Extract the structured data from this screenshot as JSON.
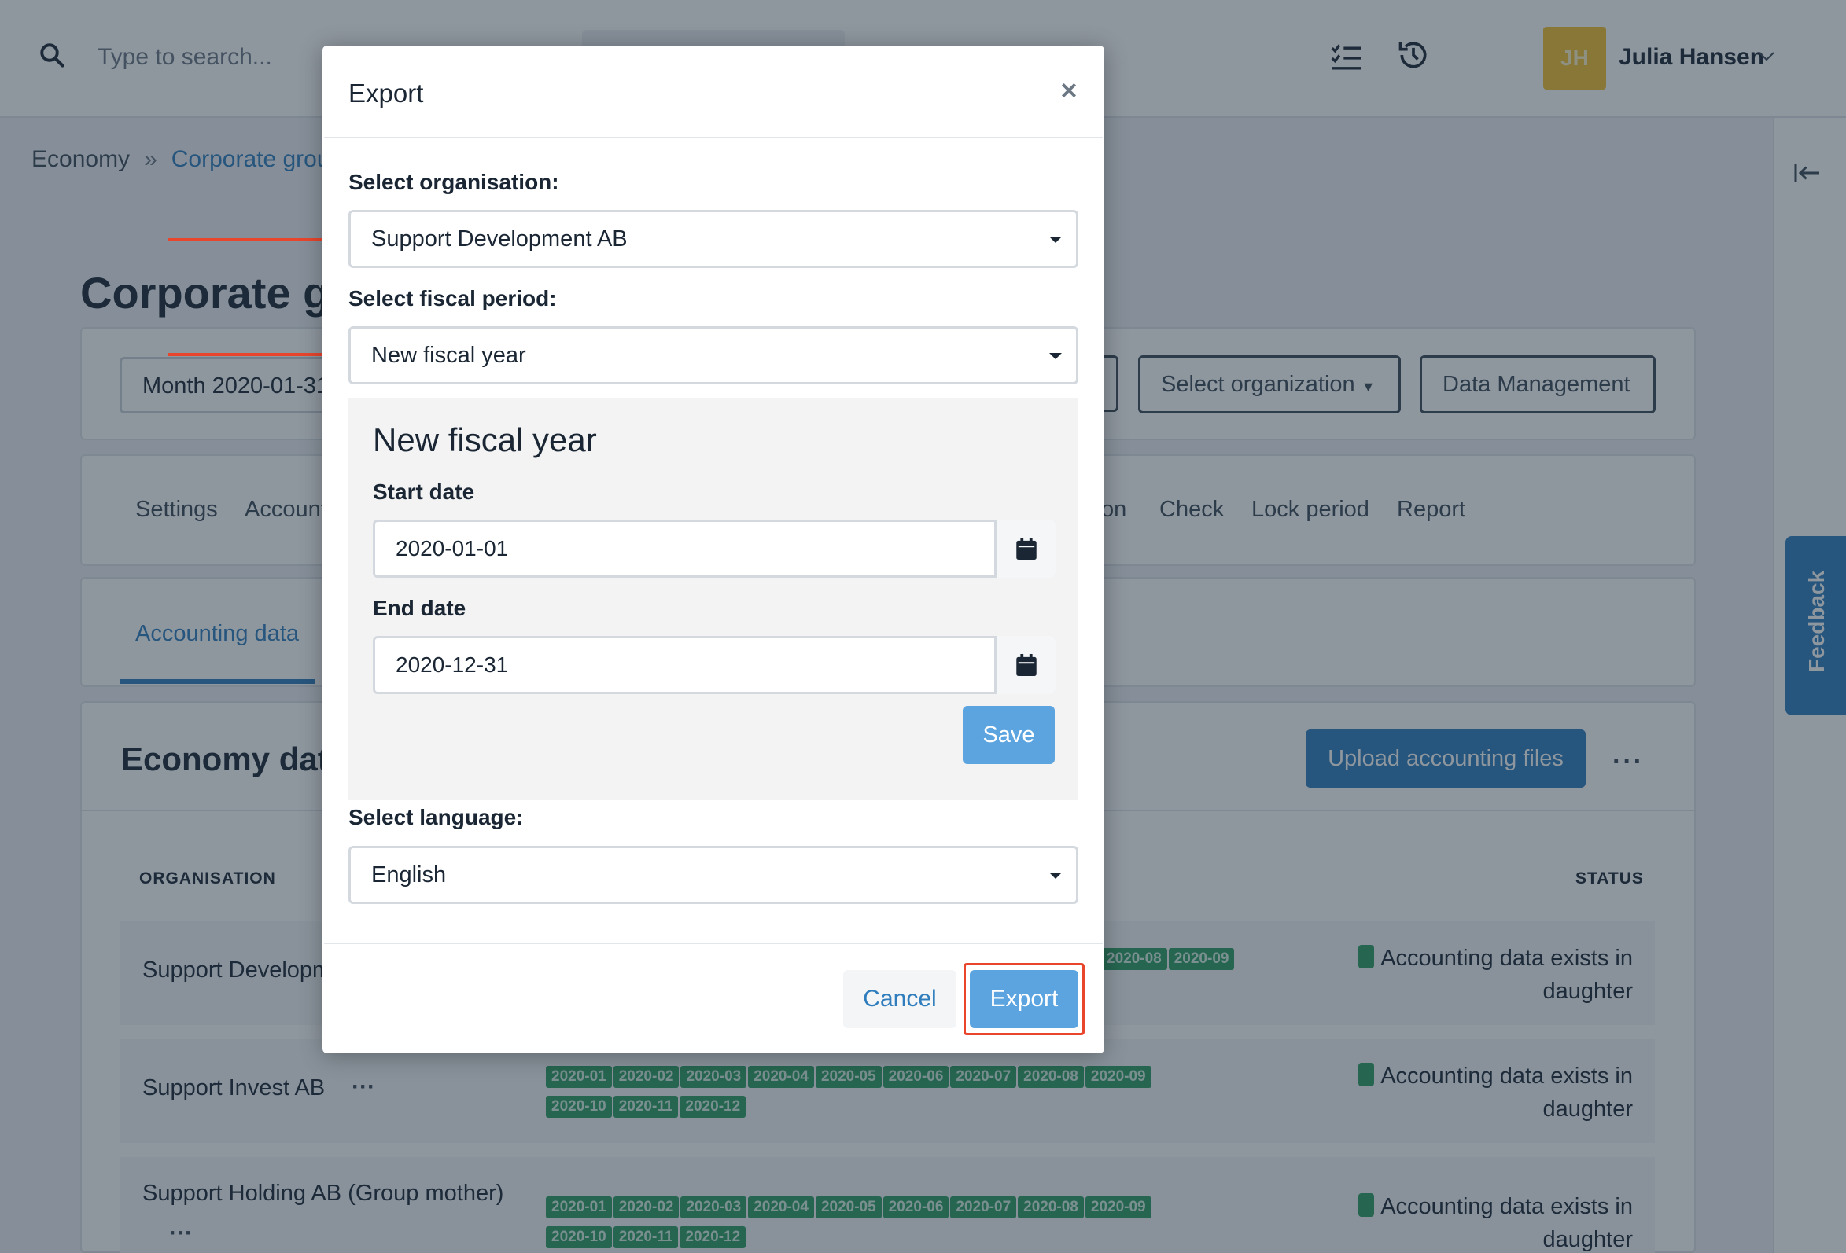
{
  "topbar": {
    "search_placeholder": "Type to search...",
    "user": {
      "initials": "JH",
      "name": "Julia Hansen"
    }
  },
  "breadcrumb": {
    "items": [
      "Economy",
      "Corporate group"
    ],
    "separator": "»"
  },
  "page": {
    "title": "Corporate group"
  },
  "filters": {
    "month_label": "Month 2020-01-31",
    "select_organization": "Select organization",
    "data_management": "Data Management"
  },
  "nav": {
    "items": [
      "Settings",
      "Accounts",
      "on",
      "Check",
      "Lock period",
      "Report"
    ]
  },
  "subtabs": {
    "active": "Accounting data"
  },
  "economy": {
    "title": "Economy data",
    "upload_button": "Upload accounting files",
    "more": "···",
    "columns": {
      "organisation": "ORGANISATION",
      "status": "STATUS"
    },
    "rows": [
      {
        "name": "Support Development AB",
        "periods": [
          "2020-08",
          "2020-09"
        ],
        "status": "Accounting data exists in daughter"
      },
      {
        "name": "Support Invest AB",
        "dots": "···",
        "periods": [
          "2020-01",
          "2020-02",
          "2020-03",
          "2020-04",
          "2020-05",
          "2020-06",
          "2020-07",
          "2020-08",
          "2020-09",
          "2020-10",
          "2020-11",
          "2020-12"
        ],
        "status": "Accounting data exists in daughter"
      },
      {
        "name": "Support Holding AB (Group mother)",
        "dots": "···",
        "periods": [
          "2020-01",
          "2020-02",
          "2020-03",
          "2020-04",
          "2020-05",
          "2020-06",
          "2020-07",
          "2020-08",
          "2020-09",
          "2020-10",
          "2020-11",
          "2020-12"
        ],
        "status": "Accounting data exists in daughter"
      }
    ]
  },
  "feedback": {
    "label": "Feedback"
  },
  "modal": {
    "title": "Export",
    "org_label": "Select organisation:",
    "org_value": "Support Development AB",
    "period_label": "Select fiscal period:",
    "period_value": "New fiscal year",
    "fiscal_year": {
      "title": "New fiscal year",
      "start_label": "Start date",
      "start_value": "2020-01-01",
      "end_label": "End date",
      "end_value": "2020-12-31",
      "save": "Save"
    },
    "language_label": "Select language:",
    "language_value": "English",
    "cancel": "Cancel",
    "export": "Export"
  },
  "colors": {
    "accent": "#2f7dbd",
    "button_light": "#5ba4e0",
    "status_green": "#2e9e63",
    "annotation_red": "#e8452c",
    "avatar": "#f2c12e"
  }
}
